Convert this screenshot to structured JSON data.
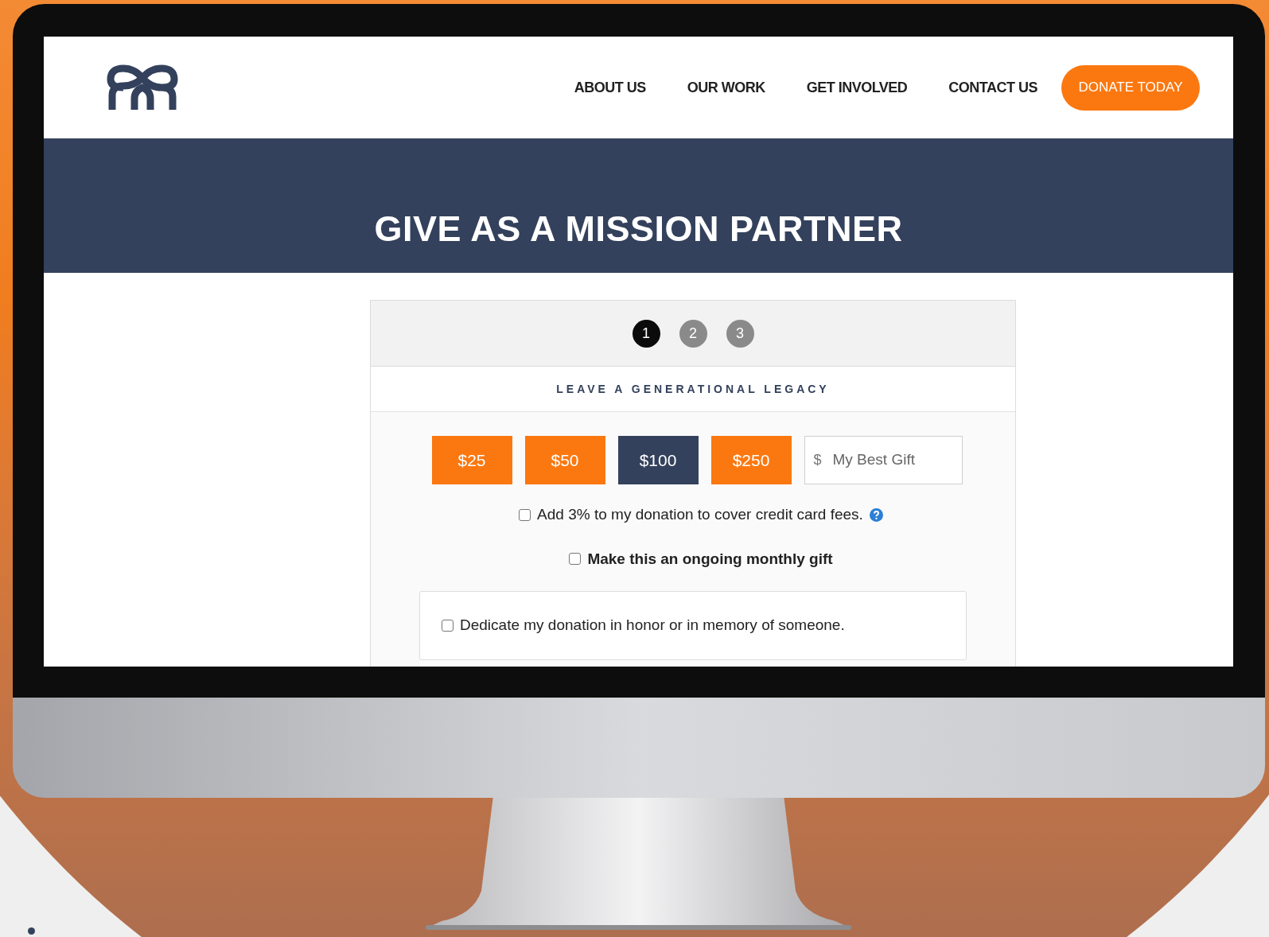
{
  "nav": {
    "items": [
      {
        "label": "ABOUT US"
      },
      {
        "label": "OUR WORK"
      },
      {
        "label": "GET INVOLVED"
      },
      {
        "label": "CONTACT US"
      }
    ],
    "cta": "DONATE TODAY"
  },
  "banner": {
    "title": "GIVE AS A MISSION PARTNER"
  },
  "steps": [
    {
      "label": "1",
      "selected": true
    },
    {
      "label": "2",
      "selected": false
    },
    {
      "label": "3",
      "selected": false
    }
  ],
  "form": {
    "heading": "LEAVE A GENERATIONAL LEGACY",
    "amounts": [
      {
        "label": "$25",
        "selected": false
      },
      {
        "label": "$50",
        "selected": false
      },
      {
        "label": "$100",
        "selected": true
      },
      {
        "label": "$250",
        "selected": false
      }
    ],
    "custom_amount": {
      "prefix": "$",
      "placeholder": "My Best Gift"
    },
    "options": [
      {
        "label": "Add 3% to my donation to cover credit card fees.",
        "checked": false,
        "help": true
      },
      {
        "label": "Make this an ongoing monthly gift",
        "checked": false,
        "help": false
      }
    ],
    "dedication": {
      "label": "Dedicate my donation in honor or in memory of someone.",
      "checked": false
    }
  }
}
